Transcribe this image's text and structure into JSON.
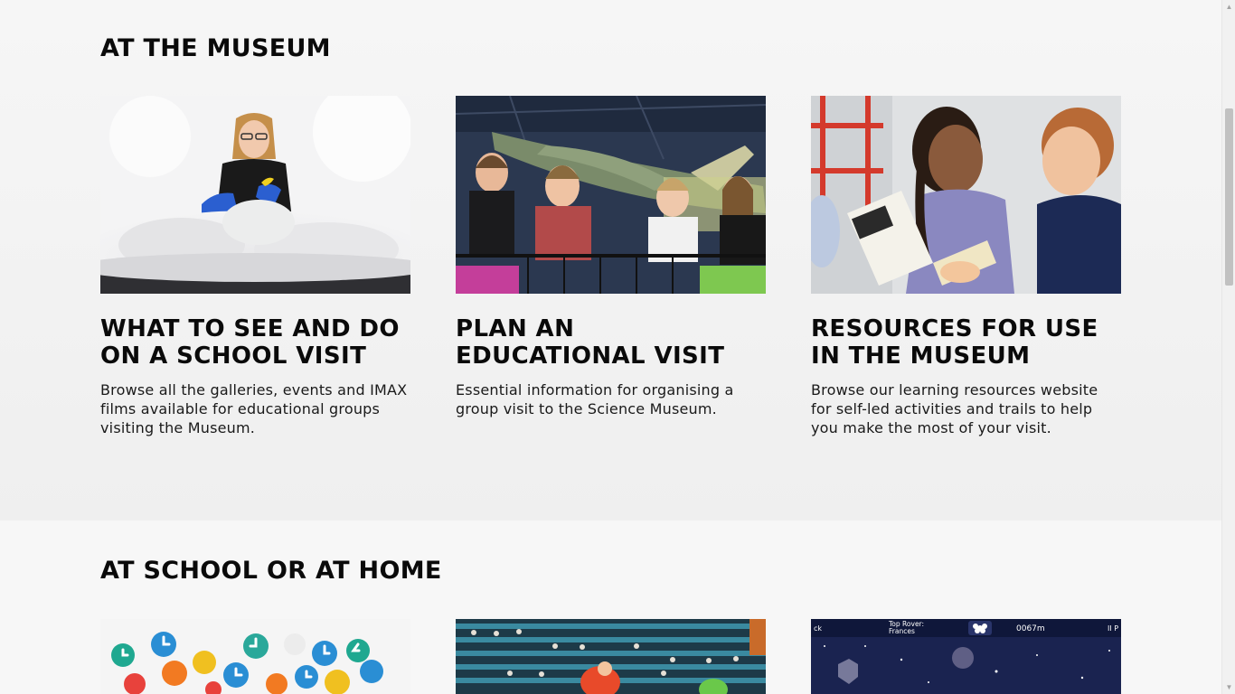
{
  "sections": {
    "museum": {
      "title": "AT THE MUSEUM",
      "cards": [
        {
          "title": "WHAT TO SEE AND DO ON A SCHOOL VISIT",
          "description": "Browse all the galleries, events and IMAX films available for educational groups visiting the Museum."
        },
        {
          "title": "PLAN AN EDUCATIONAL VISIT",
          "description": "Essential information for organising a group visit to the Science Museum."
        },
        {
          "title": "RESOURCES FOR USE IN THE MUSEUM",
          "description": "Browse our learning resources website for self-led activities and trails to help you make the most of your visit."
        }
      ]
    },
    "school": {
      "title": "AT SCHOOL OR AT HOME",
      "game_hud": {
        "back": "ck",
        "rover_line1": "Top Rover:",
        "rover_line2": "Frances",
        "distance": "0067m",
        "pause": "II P"
      }
    }
  }
}
